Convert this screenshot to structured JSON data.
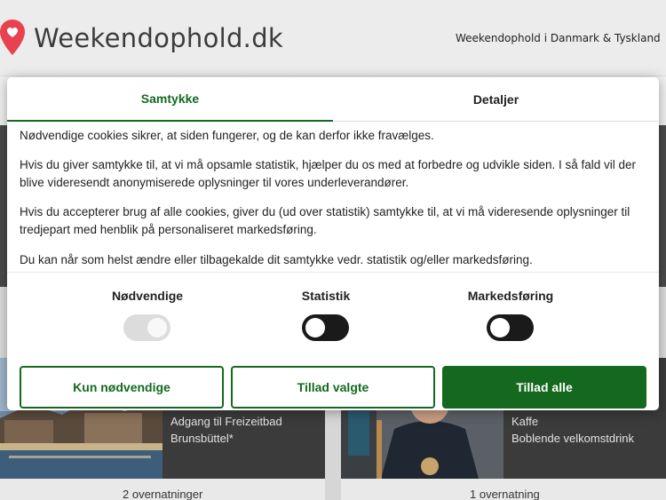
{
  "site": {
    "logo_text": "Weekendophold.dk",
    "tagline": "Weekendophold i Danmark & Tyskland"
  },
  "cards": [
    {
      "line1": "Adgang til Freizeitbad",
      "line2": "Brunsbüttel*",
      "count": "2 overnatninger"
    },
    {
      "line1": "Kaffe",
      "line2": "Boblende velkomstdrink",
      "count": "1 overnatning"
    }
  ],
  "consent": {
    "tabs": {
      "consent": "Samtykke",
      "details": "Detaljer"
    },
    "paragraphs": [
      "Nødvendige cookies sikrer, at siden fungerer, og de kan derfor ikke fravælges.",
      "Hvis du giver samtykke til, at vi må opsamle statistik, hjælper du os med at forbedre og udvikle siden. I så fald vil der blive videresendt anonymiserede oplysninger til vores underleverandører.",
      "Hvis du accepterer brug af alle cookies, giver du (ud over statistik) samtykke til, at vi må videresende oplysninger til tredjepart med henblik på personaliseret markedsføring.",
      "Du kan når som helst ændre eller tilbagekalde dit samtykke vedr. statistik og/eller markedsføring."
    ],
    "toggles": [
      {
        "label": "Nødvendige",
        "state": "on-disabled"
      },
      {
        "label": "Statistik",
        "state": "off"
      },
      {
        "label": "Markedsføring",
        "state": "off"
      }
    ],
    "buttons": {
      "necessary_only": "Kun nødvendige",
      "allow_selected": "Tillad valgte",
      "allow_all": "Tillad alle"
    }
  },
  "colors": {
    "accent": "#14691f",
    "pin": "#e8424e",
    "toggle_off": "#1a1a1a",
    "toggle_disabled": "#dcdcdc"
  }
}
